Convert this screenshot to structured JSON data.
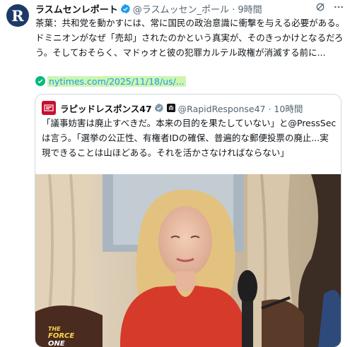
{
  "tweet": {
    "avatar_letter": "R",
    "author_name": "ラスムセンレポート",
    "handle_time": "@ラスムッセン_ポール · 9時間",
    "body": "茶葉：共和党を動かすには、常に国民の政治意識に衝撃を与える必要がある。ドミニオンがなぜ「売却」されたのかという真実が、そのきっかけとなるだろう。そしておそらく、マドゥオと彼の犯罪カルテル政権が消滅する前に...",
    "link": "nytimes.com/2025/11/18/us/..."
  },
  "quote": {
    "author_name": "ラピッドレスポンス47",
    "meta": "@RapidResponse47 · 10時間",
    "body": "「議事妨害は廃止すべきだ。本来の目的を果たしていない」と@PressSecは言う。「選挙の公正性、有権者IDの確保、普遍的な郵便投票の廃止...実現できることは山ほどある。それを活かさなければならない」",
    "media_logo": "THE FORCE ONE"
  },
  "colors": {
    "link": "#1d9bf0",
    "verified": "#1d9bf0",
    "link_highlight": "#cdf5b0",
    "muted": "#536471"
  }
}
